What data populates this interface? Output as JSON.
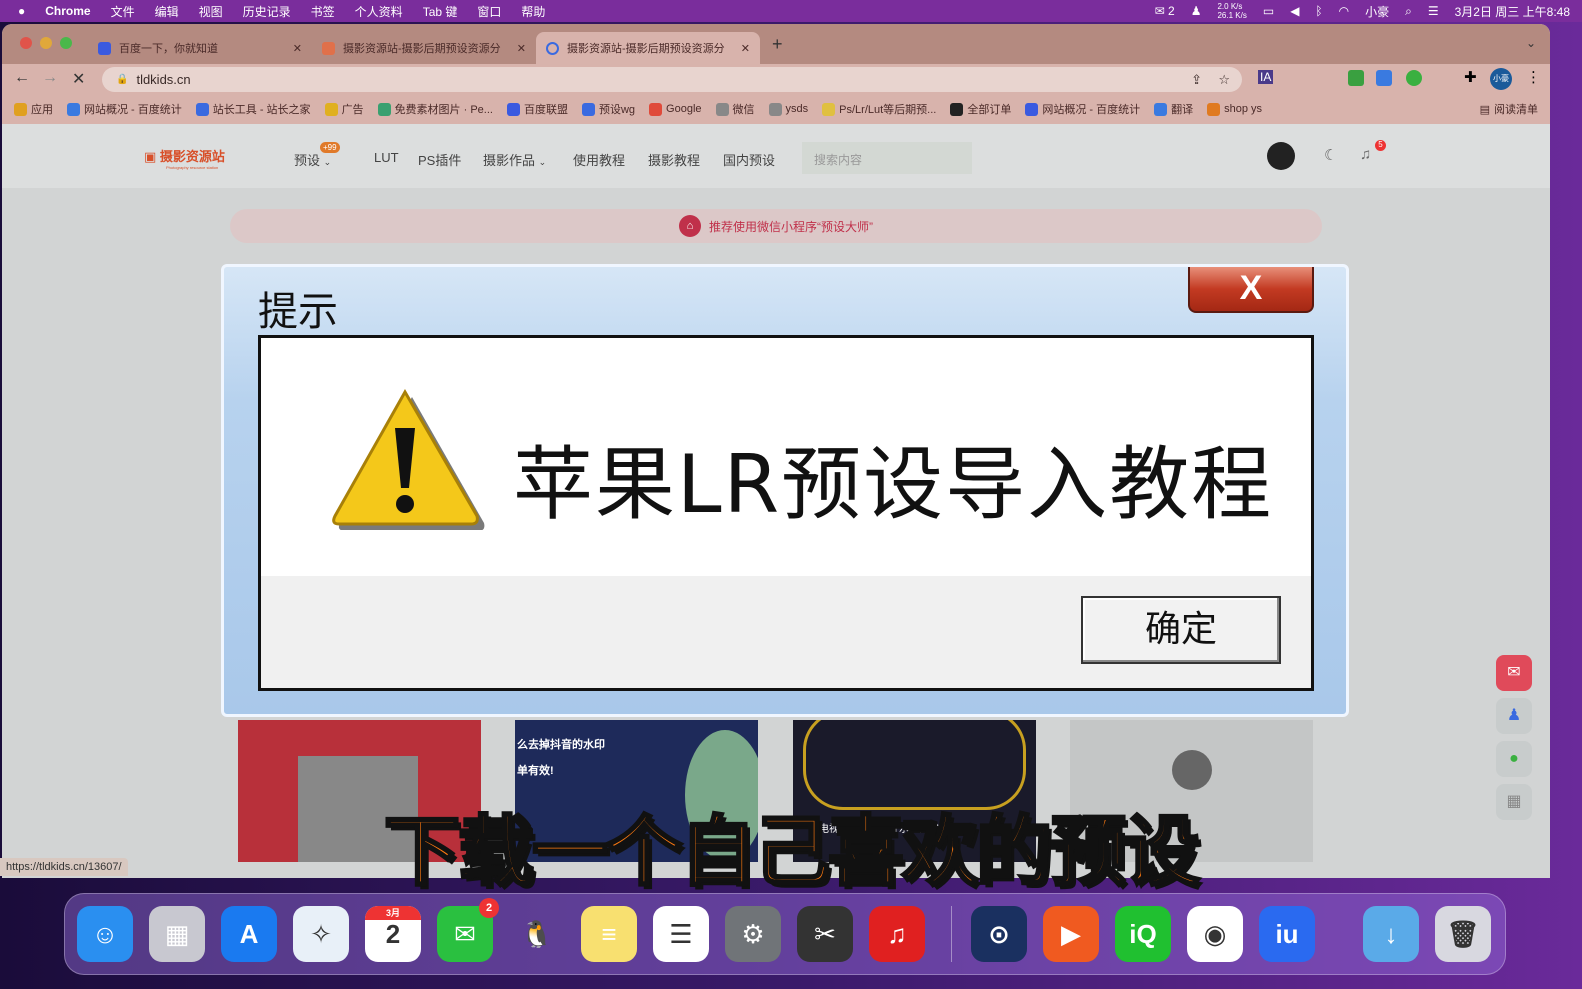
{
  "menubar": {
    "app": "Chrome",
    "items": [
      "文件",
      "编辑",
      "视图",
      "历史记录",
      "书签",
      "个人资料",
      "Tab 键",
      "窗口",
      "帮助"
    ],
    "wechat_count": "2",
    "net_up": "2.0 K/s",
    "net_down": "26.1 K/s",
    "user": "小豪",
    "datetime": "3月2日 周三 上午8:48"
  },
  "tabs": [
    {
      "title": "百度一下，你就知道",
      "active": false
    },
    {
      "title": "摄影资源站-摄影后期预设资源分",
      "active": false
    },
    {
      "title": "摄影资源站-摄影后期预设资源分",
      "active": true
    }
  ],
  "new_tab": "+",
  "address": "tldkids.cn",
  "profile": "小豪",
  "bookmarks": [
    "应用",
    "网站概况 - 百度统计",
    "站长工具 - 站长之家",
    "广告",
    "免费素材图片 · Pe...",
    "百度联盟",
    "预设wg",
    "Google",
    "微信",
    "ysds",
    "Ps/Lr/Lut等后期预...",
    "全部订单",
    "网站概况 - 百度统计",
    "翻译",
    "shop ys"
  ],
  "reading_list": "阅读清单",
  "site": {
    "logo": "摄影资源站",
    "logo_sub": "Photography resource station",
    "nav": [
      "预设",
      "LUT",
      "PS插件",
      "摄影作品",
      "使用教程",
      "摄影教程",
      "国内预设"
    ],
    "nav_badge": "+99",
    "search_placeholder": "搜索内容",
    "notif_count": "5",
    "banner": "推荐使用微信小程序“预设大师”"
  },
  "cards": [
    "么去掉抖音的水印",
    "单有效!",
    "电视台曝光了：开水里面加上这个,"
  ],
  "dialog": {
    "title": "提示",
    "close": "X",
    "message": "苹果LR预设导入教程",
    "ok": "确定"
  },
  "subtitle": "下载一个自己喜欢的预设",
  "status_url": "https://tldkids.cn/13607/",
  "dock": [
    {
      "name": "finder",
      "bg": "#2a8ff0",
      "g": "☺"
    },
    {
      "name": "launchpad",
      "bg": "#c8c8d0",
      "g": "▦"
    },
    {
      "name": "app-store",
      "bg": "#1a7af0",
      "g": "A"
    },
    {
      "name": "safari",
      "bg": "#e8f0f8",
      "g": "✧"
    },
    {
      "name": "calendar",
      "bg": "#ffffff",
      "g": "2",
      "label": "3月"
    },
    {
      "name": "wechat",
      "bg": "#2ac040",
      "g": "✉",
      "badge": "2"
    },
    {
      "name": "qq",
      "bg": "transparent",
      "g": "🐧"
    },
    {
      "name": "notes",
      "bg": "#f8e070",
      "g": "≡"
    },
    {
      "name": "reminders",
      "bg": "#ffffff",
      "g": "☰"
    },
    {
      "name": "system-preferences",
      "bg": "#707478",
      "g": "⚙"
    },
    {
      "name": "final-cut-pro",
      "bg": "#333",
      "g": "✂"
    },
    {
      "name": "netease-music",
      "bg": "#e02020",
      "g": "♫"
    },
    {
      "name": "steam",
      "bg": "#1a3060",
      "g": "⊙"
    },
    {
      "name": "infuse",
      "bg": "#f05a20",
      "g": "▶"
    },
    {
      "name": "iqiyi",
      "bg": "#20c030",
      "g": "iQ"
    },
    {
      "name": "chrome",
      "bg": "#ffffff",
      "g": "◉"
    },
    {
      "name": "iu-app",
      "bg": "#2a6af0",
      "g": "iu"
    },
    {
      "name": "downloads",
      "bg": "#5aaae8",
      "g": "↓"
    },
    {
      "name": "trash",
      "bg": "#d8d8e0",
      "g": "🗑"
    }
  ]
}
